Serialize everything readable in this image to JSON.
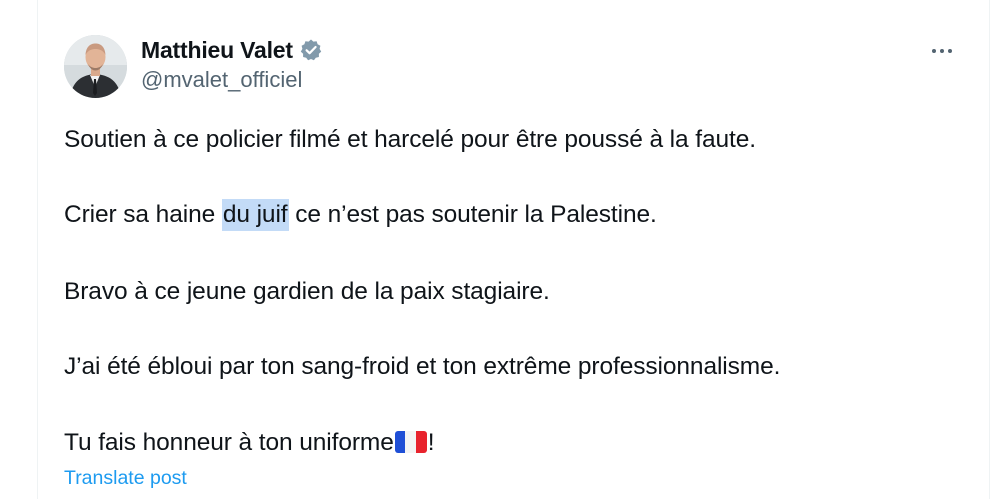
{
  "post": {
    "author": {
      "display_name": "Matthieu Valet",
      "handle": "@mvalet_officiel",
      "verified": true,
      "avatar": "profile-photo"
    },
    "more_icon": "more-horizontal-icon",
    "lines": {
      "l1": "Soutien à ce policier filmé et harcelé pour être poussé à la faute.",
      "l2_before": "Crier sa haine ",
      "l2_highlight": "du juif",
      "l2_after": " ce n’est pas soutenir la Palestine.",
      "l3": "Bravo à ce jeune gardien de la paix stagiaire.",
      "l4": "J’ai été ébloui par ton sang-froid et ton extrême professionnalisme.",
      "l5_before": "Tu fais honneur à ton uniforme",
      "l5_flag": "france-flag-emoji",
      "l5_after": "!"
    },
    "translate_label": "Translate post"
  },
  "colors": {
    "text": "#0f1419",
    "secondary_text": "#536471",
    "link": "#1d9bf0",
    "selection_highlight": "#c3dbf7",
    "verified_badge": "#829aab",
    "border": "#eff3f4"
  }
}
